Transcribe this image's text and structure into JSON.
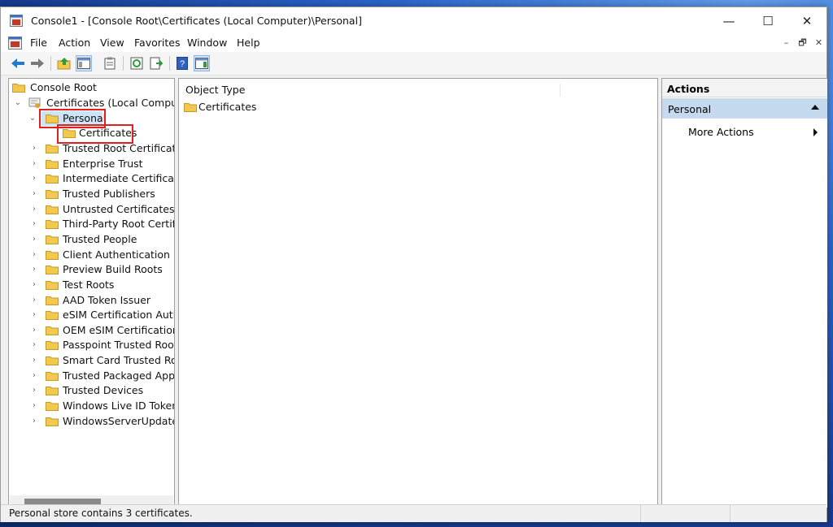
{
  "window": {
    "title": "Console1 - [Console Root\\Certificates (Local Computer)\\Personal]",
    "controls": {
      "minimize": "—",
      "maximize": "☐",
      "close": "✕"
    }
  },
  "menubar": {
    "items": [
      "File",
      "Action",
      "View",
      "Favorites",
      "Window",
      "Help"
    ],
    "mdi_controls": [
      "–",
      "🗗",
      "✕"
    ]
  },
  "toolbar": {
    "buttons": [
      {
        "name": "back-icon"
      },
      {
        "name": "forward-icon"
      },
      {
        "name": "up-one-level-icon"
      },
      {
        "name": "show-hide-console-tree-icon"
      },
      {
        "name": "properties-icon"
      },
      {
        "name": "refresh-icon"
      },
      {
        "name": "export-list-icon"
      },
      {
        "name": "help-icon"
      },
      {
        "name": "show-hide-action-pane-icon"
      }
    ]
  },
  "tree": {
    "root": "Console Root",
    "computer": "Certificates (Local Computer)",
    "personal": "Personal",
    "personal_child": "Certificates",
    "stores": [
      "Trusted Root Certification",
      "Enterprise Trust",
      "Intermediate Certification",
      "Trusted Publishers",
      "Untrusted Certificates",
      "Third-Party Root Certifica",
      "Trusted People",
      "Client Authentication Issu",
      "Preview Build Roots",
      "Test Roots",
      "AAD Token Issuer",
      "eSIM Certification Author",
      "OEM eSIM Certification A",
      "Passpoint Trusted Roots",
      "Smart Card Trusted Roots",
      "Trusted Packaged App Ins",
      "Trusted Devices",
      "Windows Live ID Token Iss",
      "WindowsServerUpdateSer"
    ]
  },
  "list": {
    "column_header": "Object Type",
    "rows": [
      "Certificates"
    ]
  },
  "actions": {
    "title": "Actions",
    "section": "Personal",
    "items": [
      "More Actions"
    ]
  },
  "status": {
    "text": "Personal store contains 3 certificates."
  },
  "colors": {
    "selection": "#cce4f7",
    "highlight_box": "#e02020",
    "action_section": "#c5d9ef",
    "folder": "#f2c94c"
  }
}
